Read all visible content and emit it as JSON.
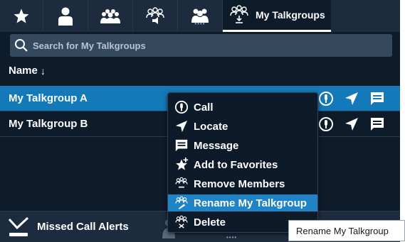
{
  "colors": {
    "background": "#0e1b2b",
    "tabbar": "#1c2b3d",
    "selected_row": "#1479b8",
    "menu_highlight": "#2083c6",
    "search_bg": "#34485e"
  },
  "tabs": [
    {
      "icon": "star-icon"
    },
    {
      "icon": "person-icon"
    },
    {
      "icon": "group-icon"
    },
    {
      "icon": "talkgroup-speaker-icon"
    },
    {
      "icon": "dispatch-group-icon"
    },
    {
      "icon": "my-talkgroups-icon",
      "label": "My Talkgroups",
      "active": true
    }
  ],
  "search": {
    "placeholder": "Search for My Talkgroups"
  },
  "list": {
    "column_header": "Name",
    "sort_indicator": "↓",
    "rows": [
      {
        "name": "My Talkgroup A",
        "selected": true
      },
      {
        "name": "My Talkgroup B",
        "selected": false
      }
    ]
  },
  "context_menu": {
    "items": [
      {
        "label": "Call",
        "icon": "call-icon"
      },
      {
        "label": "Locate",
        "icon": "locate-icon"
      },
      {
        "label": "Message",
        "icon": "message-icon"
      },
      {
        "label": "Add to Favorites",
        "icon": "add-favorite-icon"
      },
      {
        "label": "Remove Members",
        "icon": "remove-members-icon"
      },
      {
        "label": "Rename My Talkgroup",
        "icon": "rename-talkgroup-icon",
        "highlighted": true
      },
      {
        "label": "Delete",
        "icon": "delete-talkgroup-icon"
      }
    ]
  },
  "bottom_bar": {
    "missed_calls_label": "Missed Call Alerts"
  },
  "tooltip": {
    "text": "Rename My Talkgroup"
  }
}
